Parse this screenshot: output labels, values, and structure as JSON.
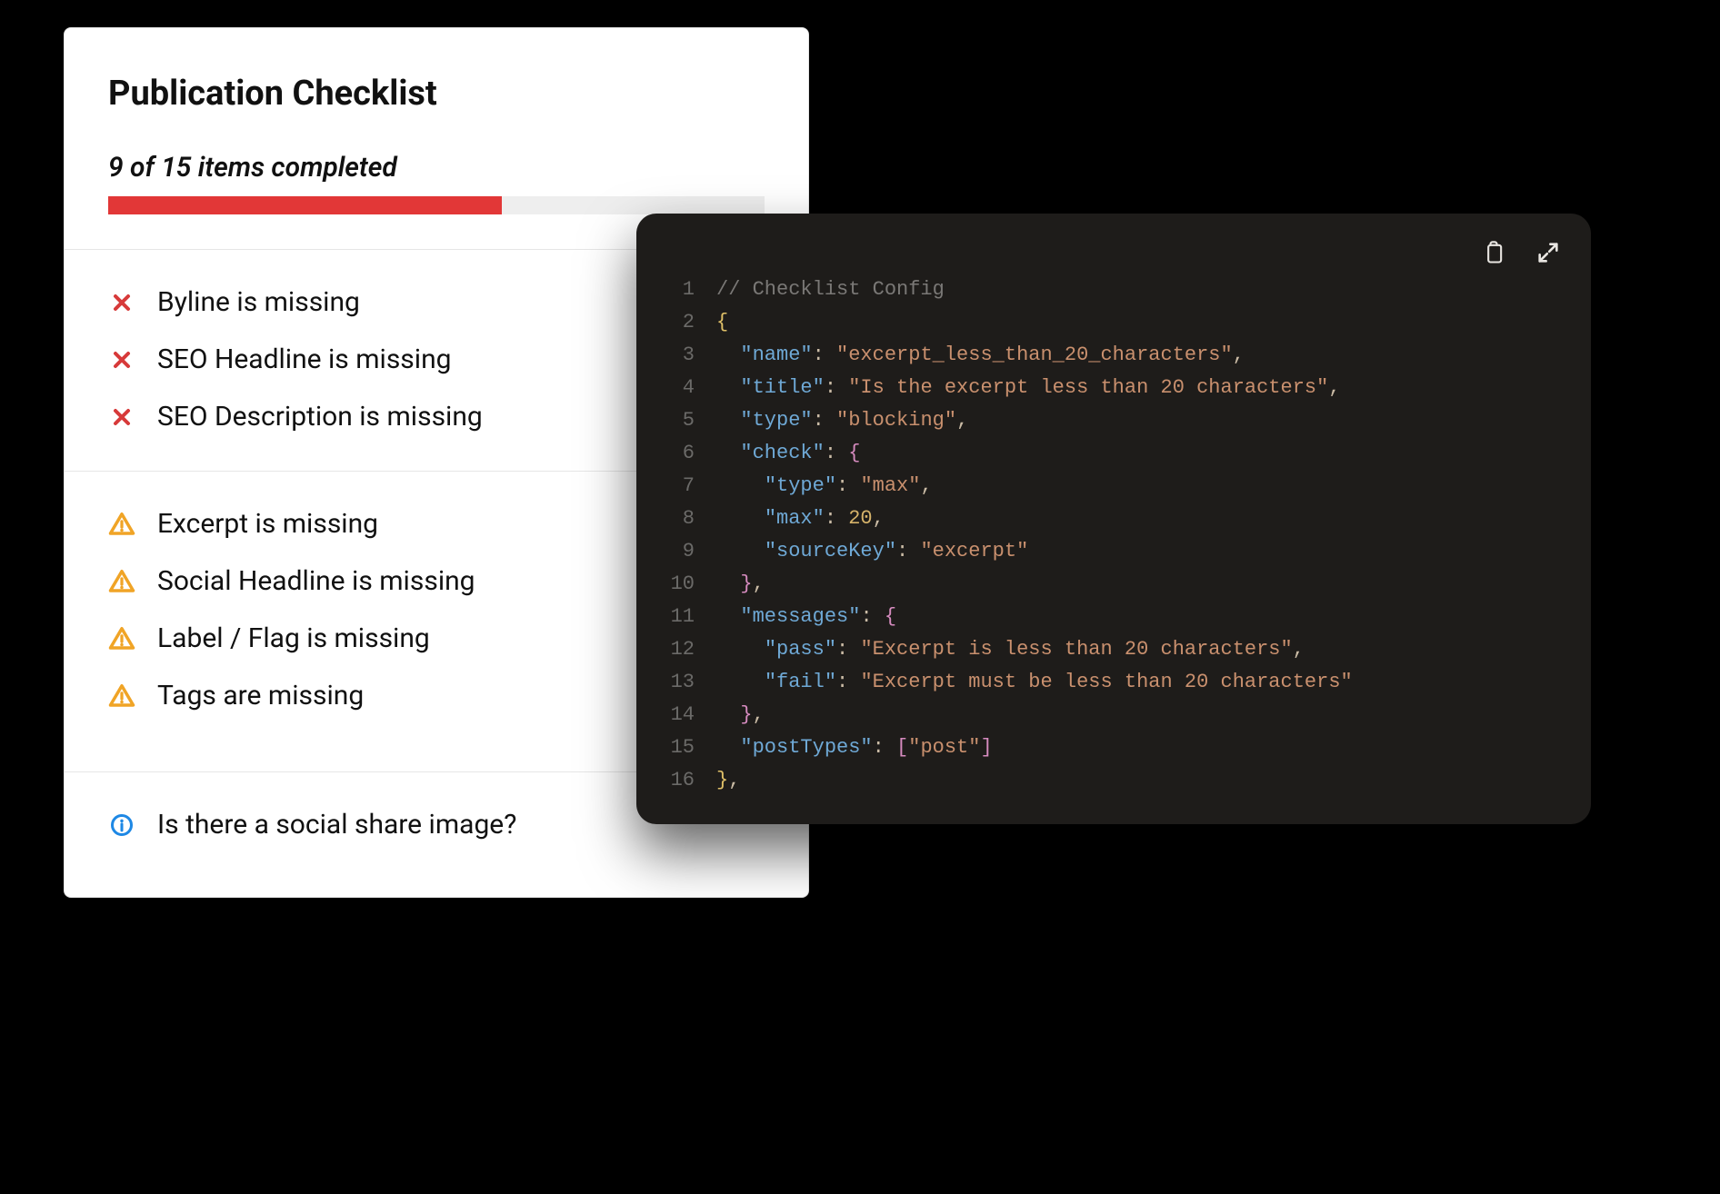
{
  "checklist": {
    "title": "Publication Checklist",
    "progress": {
      "label": "9 of 15 items completed",
      "completed": 9,
      "total": 15,
      "percent": 60
    },
    "sections": [
      {
        "type": "error",
        "items": [
          {
            "icon": "x-icon",
            "text": "Byline is missing"
          },
          {
            "icon": "x-icon",
            "text": "SEO Headline is missing"
          },
          {
            "icon": "x-icon",
            "text": "SEO Description is missing"
          }
        ]
      },
      {
        "type": "warning",
        "items": [
          {
            "icon": "warning-icon",
            "text": "Excerpt is missing"
          },
          {
            "icon": "warning-icon",
            "text": "Social Headline is missing"
          },
          {
            "icon": "warning-icon",
            "text": "Label / Flag is missing"
          },
          {
            "icon": "warning-icon",
            "text": "Tags are missing"
          }
        ]
      },
      {
        "type": "info",
        "items": [
          {
            "icon": "info-icon",
            "text": "Is there a social share image?"
          }
        ]
      }
    ]
  },
  "code": {
    "comment": "// Checklist Config",
    "lines": [
      "1",
      "2",
      "3",
      "4",
      "5",
      "6",
      "7",
      "8",
      "9",
      "10",
      "11",
      "12",
      "13",
      "14",
      "15",
      "16"
    ],
    "name_key": "\"name\"",
    "name_val": "\"excerpt_less_than_20_characters\"",
    "title_key": "\"title\"",
    "title_val": "\"Is the excerpt less than 20 characters\"",
    "type_key": "\"type\"",
    "type_val": "\"blocking\"",
    "check_key": "\"check\"",
    "check_type_key": "\"type\"",
    "check_type_val": "\"max\"",
    "max_key": "\"max\"",
    "max_val": "20",
    "src_key": "\"sourceKey\"",
    "src_val": "\"excerpt\"",
    "messages_key": "\"messages\"",
    "pass_key": "\"pass\"",
    "pass_val": "\"Excerpt is less than 20 characters\"",
    "fail_key": "\"fail\"",
    "fail_val": "\"Excerpt must be less than 20 characters\"",
    "posttypes_key": "\"postTypes\"",
    "posttypes_val": "\"post\""
  },
  "icons": {
    "clipboard": "clipboard-icon",
    "expand": "expand-icon"
  }
}
